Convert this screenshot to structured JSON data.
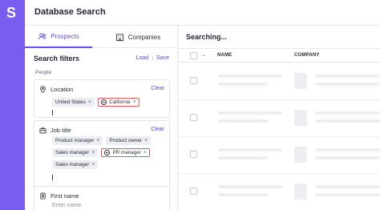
{
  "app": {
    "logo": "S",
    "title": "Database Search"
  },
  "tabs": [
    {
      "label": "Prospects",
      "icon": "people-icon",
      "active": true
    },
    {
      "label": "Companies",
      "icon": "building-icon",
      "active": false
    }
  ],
  "filters": {
    "title": "Search filters",
    "load_label": "Load",
    "separator": "|",
    "save_label": "Save",
    "section_label": "People",
    "location": {
      "label": "Location",
      "clear_label": "Clear",
      "chips": [
        {
          "text": "United States",
          "excluded": false
        },
        {
          "text": "California",
          "excluded": true
        }
      ]
    },
    "job_title": {
      "label": "Job title",
      "clear_label": "Clear",
      "chips": [
        {
          "text": "Product manager",
          "excluded": false
        },
        {
          "text": "Product owner",
          "excluded": false
        },
        {
          "text": "Sales manager",
          "excluded": false
        },
        {
          "text": "PR manager",
          "excluded": true
        },
        {
          "text": "Sales manager",
          "excluded": false
        }
      ]
    },
    "first_name": {
      "label": "First name",
      "placeholder": "Enter name"
    }
  },
  "results": {
    "status": "Searching...",
    "columns": {
      "name": "NAME",
      "company": "COMPANY"
    }
  },
  "colors": {
    "accent": "#7b5cf0",
    "exclude": "#e05b5b"
  }
}
